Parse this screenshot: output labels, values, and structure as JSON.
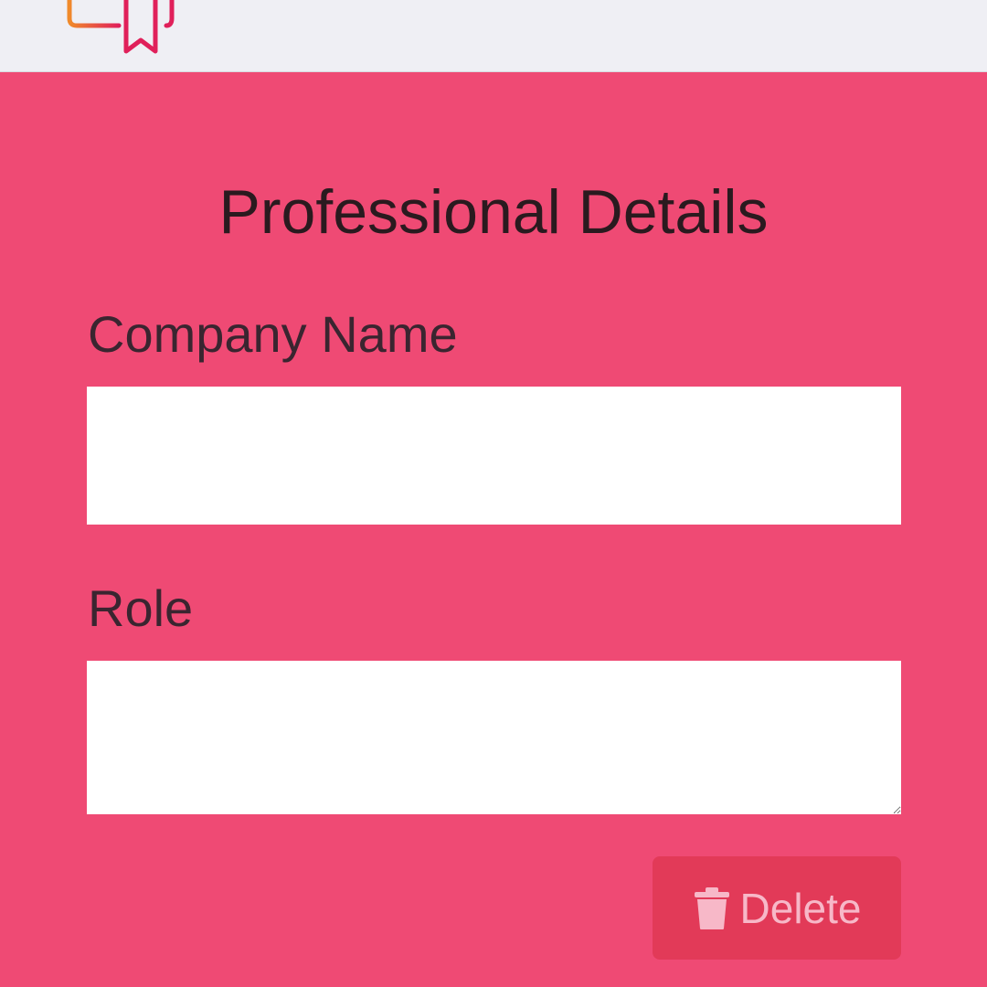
{
  "header": {
    "logo_icon": "certificate-ribbon-icon"
  },
  "form": {
    "title": "Professional Details",
    "company_label": "Company Name",
    "company_value": "",
    "role_label": "Role",
    "role_value": "",
    "delete_label": "Delete",
    "delete_icon": "trash-icon"
  },
  "colors": {
    "background": "#ef4a74",
    "topbar": "#efeff4",
    "delete_button": "#e23a58",
    "delete_text": "#f7b8c8"
  }
}
